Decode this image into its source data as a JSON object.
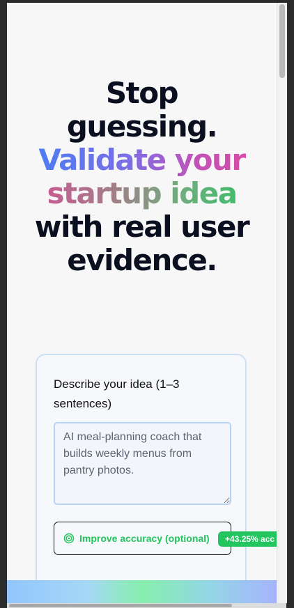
{
  "hero": {
    "line1": "Stop",
    "line2": "guessing.",
    "line3": "Validate your",
    "line4": "startup idea",
    "line5": "with real user",
    "line6": "evidence."
  },
  "form": {
    "idea_label": "Describe your idea (1–3 sentences)",
    "idea_placeholder": "AI meal-planning coach that builds weekly menus from pantry photos.",
    "idea_value": "",
    "improve_label": "Improve accuracy (optional)",
    "improve_icon": "target-icon",
    "accuracy_badge": "+43.25% acc"
  },
  "colors": {
    "accent_green": "#22c55e",
    "gradient_blue": "#3b82f6",
    "gradient_pink": "#e0489a",
    "headline": "#0b1020"
  }
}
